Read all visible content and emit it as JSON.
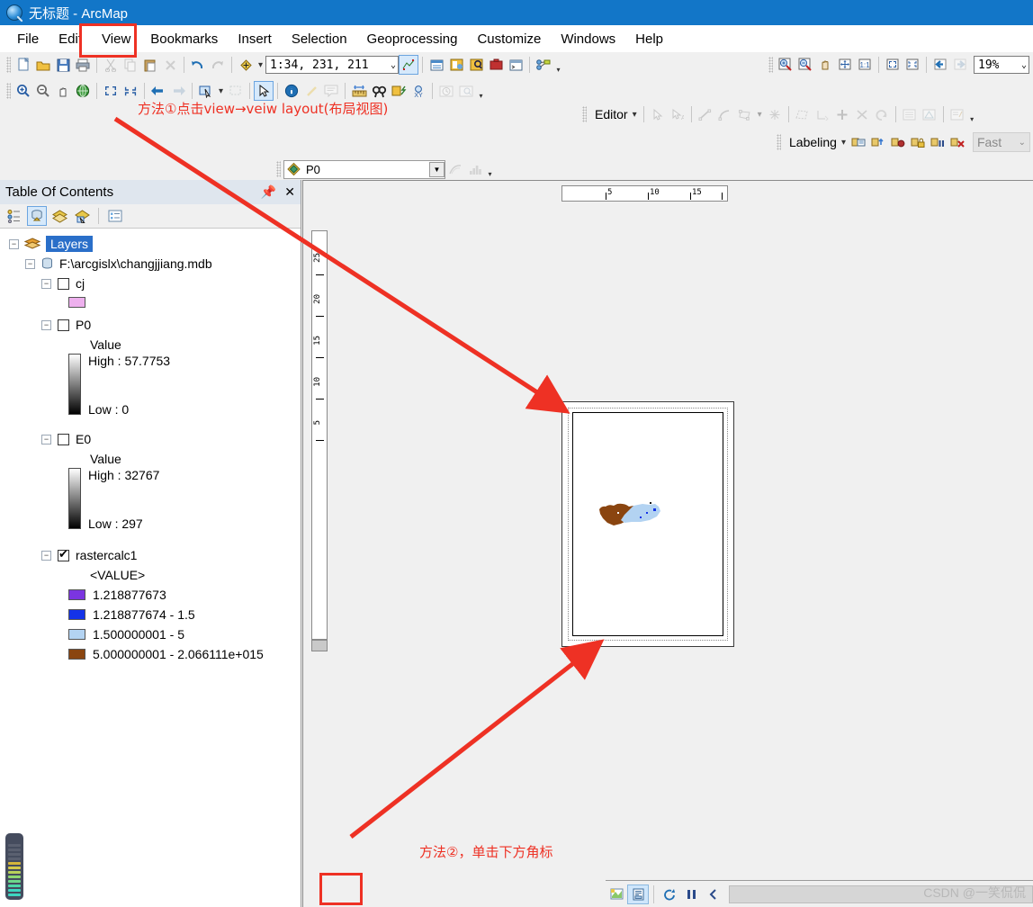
{
  "window": {
    "title": "无标题 - ArcMap",
    "app_icon": "arcmap-globe-icon"
  },
  "menu": {
    "items": [
      {
        "label": "File"
      },
      {
        "label": "Edit"
      },
      {
        "label": "View"
      },
      {
        "label": "Bookmarks"
      },
      {
        "label": "Insert"
      },
      {
        "label": "Selection"
      },
      {
        "label": "Geoprocessing"
      },
      {
        "label": "Customize"
      },
      {
        "label": "Windows"
      },
      {
        "label": "Help"
      }
    ]
  },
  "standard_toolbar": {
    "scale_value": "1:34, 231, 211",
    "buttons": [
      "new-document-icon",
      "open-folder-icon",
      "save-icon",
      "print-icon",
      "cut-icon",
      "copy-icon",
      "paste-icon",
      "delete-icon",
      "undo-icon",
      "redo-icon",
      "add-data-icon",
      "editor-toolbar-icon",
      "table-of-contents-icon",
      "catalog-icon",
      "search-icon",
      "toolbox-icon",
      "python-window-icon",
      "model-builder-icon"
    ]
  },
  "tools_toolbar": {
    "buttons": [
      "zoom-in-icon",
      "zoom-out-icon",
      "pan-icon",
      "full-extent-icon",
      "fixed-zoom-in-icon",
      "fixed-zoom-out-icon",
      "go-back-extent-icon",
      "go-forward-extent-icon",
      "select-features-icon",
      "clear-selection-icon",
      "select-elements-icon",
      "identify-icon",
      "hyperlink-icon",
      "html-popup-icon",
      "measure-icon",
      "find-icon",
      "find-route-icon",
      "go-to-xy-icon",
      "time-slider-icon",
      "create-viewer-window-icon"
    ]
  },
  "layout_toolbar": {
    "zoom_level": "19%",
    "buttons": [
      "zoom-in-page-icon",
      "zoom-out-page-icon",
      "pan-page-icon",
      "zoom-whole-page-icon",
      "zoom-100-percent-icon",
      "fixed-zoom-in-page-icon",
      "fixed-zoom-out-page-icon",
      "go-back-extent-icon",
      "go-forward-extent-icon"
    ]
  },
  "editor_toolbar": {
    "label": "Editor",
    "buttons": [
      "edit-tool-icon",
      "edit-annotation-icon",
      "straight-segment-icon",
      "end-point-arc-icon",
      "trace-icon",
      "point-icon",
      "edit-vertices-icon",
      "reshape-feature-icon",
      "cut-polygons-icon",
      "split-icon",
      "rotate-icon",
      "attributes-icon",
      "sketch-properties-icon",
      "create-features-icon"
    ]
  },
  "labeling_toolbar": {
    "label": "Labeling",
    "quality": "Fast",
    "buttons": [
      "label-manager-icon",
      "label-priority-icon",
      "label-weight-icon",
      "lock-labels-icon",
      "pause-labeling-icon",
      "view-unplaced-labels-icon"
    ]
  },
  "layer_combo": {
    "value": "P0",
    "icon": "data-frame-icon",
    "extra_buttons": [
      "image-analysis-icon",
      "histogram-icon"
    ]
  },
  "toc": {
    "title": "Table Of Contents",
    "pin_icon": "pin-icon",
    "close_icon": "close-icon",
    "toolbar_buttons": [
      "list-by-drawing-order-icon",
      "list-by-source-icon",
      "list-by-visibility-icon",
      "list-by-selection-icon",
      "options-icon"
    ],
    "tree": {
      "root": "Layers",
      "geodatabase": "F:\\arcgislx\\changjjiang.mdb",
      "layers": [
        {
          "name": "cj",
          "checked": false,
          "type": "polygon",
          "swatch_color": "#eeb0ee"
        },
        {
          "name": "P0",
          "checked": false,
          "type": "raster-stretch",
          "value_label": "Value",
          "high": "High : 57.7753",
          "low": "Low : 0"
        },
        {
          "name": "E0",
          "checked": false,
          "type": "raster-stretch",
          "value_label": "Value",
          "high": "High : 32767",
          "low": "Low : 297"
        },
        {
          "name": "rastercalc1",
          "checked": true,
          "type": "raster-classified",
          "value_label": "<VALUE>",
          "classes": [
            {
              "color": "#7b35e0",
              "label": "1.218877673"
            },
            {
              "color": "#1433e8",
              "label": "1.218877674 - 1.5"
            },
            {
              "color": "#b3d3f2",
              "label": "1.500000001 - 5"
            },
            {
              "color": "#8a4510",
              "label": "5.000000001 - 2.066111e+015"
            }
          ]
        }
      ]
    }
  },
  "layout_view": {
    "h_ruler_ticks": [
      "5",
      "10",
      "15"
    ],
    "v_ruler_ticks": [
      "25",
      "20",
      "15",
      "10",
      "5"
    ],
    "map_colors": {
      "brown": "#8a4510",
      "light_blue": "#b3d3f2",
      "blue": "#1433e8"
    }
  },
  "status_bar": {
    "view_buttons": [
      "data-view-icon",
      "layout-view-icon"
    ],
    "selected_view": "layout-view-icon",
    "refresh_icon": "refresh-icon",
    "pause_icon": "pause-drawing-icon",
    "back_icon": "previous-extent-icon"
  },
  "annotations": [
    {
      "id": "anno-1",
      "text": "方法①点击view→veiw layout(布局视图)"
    },
    {
      "id": "anno-2",
      "text": "方法②，单击下方角标"
    }
  ],
  "watermark": "CSDN @一笑侃侃",
  "colors": {
    "accent": "#ee3124",
    "title_bar": "#1276c8",
    "selection": "#2a6fc9"
  }
}
